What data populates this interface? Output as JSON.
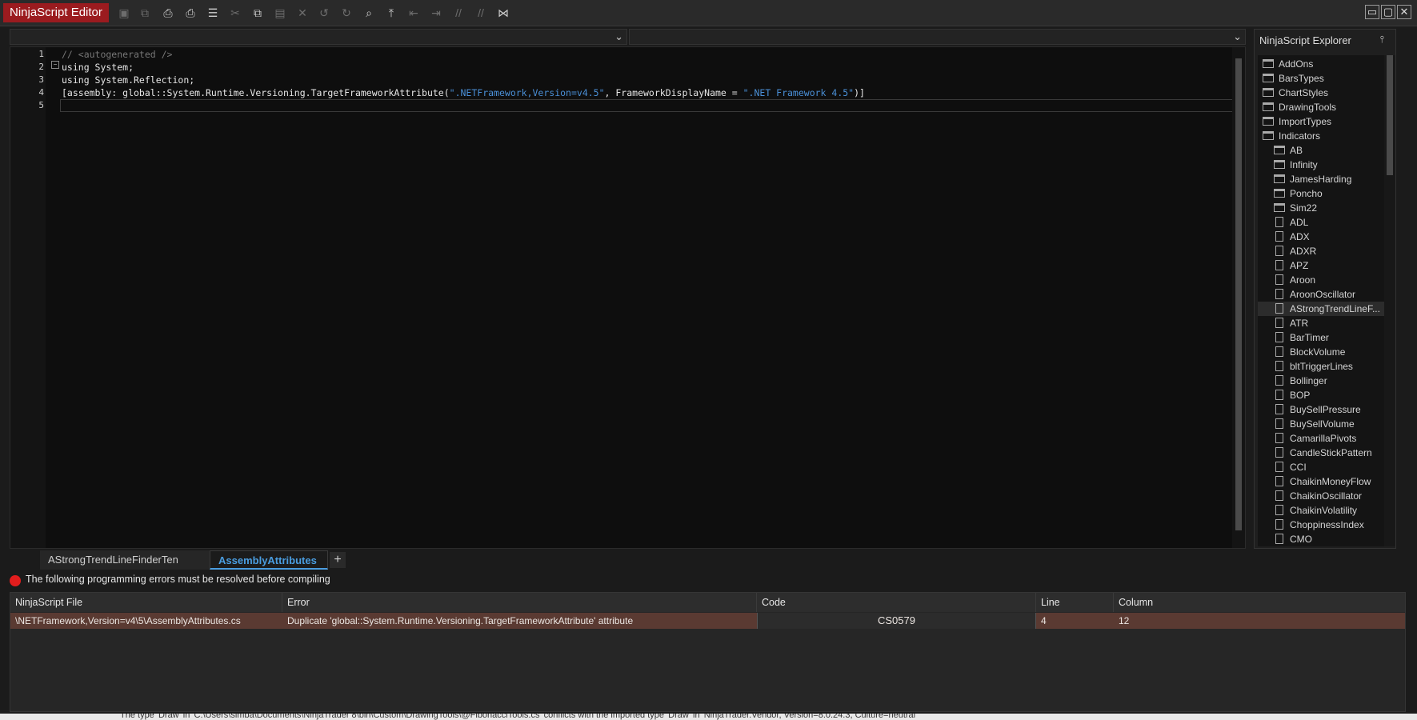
{
  "window": {
    "title": "NinjaScript Editor",
    "toolbar_icons": [
      "save-icon",
      "save-all-icon",
      "print-icon",
      "print-preview-icon",
      "template-icon",
      "cut-icon",
      "copy-icon",
      "paste-icon",
      "delete-icon",
      "undo-icon",
      "redo-icon",
      "find-icon",
      "insert-icon",
      "outdent-icon",
      "indent-icon",
      "comment-icon",
      "uncomment-icon",
      "visual-studio-icon"
    ],
    "controls": {
      "minimize": "▭",
      "maximize": "▢",
      "close": "✕"
    }
  },
  "editor": {
    "line_numbers": [
      "1",
      "2",
      "3",
      "4",
      "5"
    ],
    "lines": {
      "l1": "// <autogenerated />",
      "l2": "using System;",
      "l3": "using System.Reflection;",
      "l4_a": "[assembly: global::System.Runtime.Versioning.TargetFrameworkAttribute(",
      "l4_s1": "\".NETFramework,Version=v4.5\"",
      "l4_b": ", FrameworkDisplayName = ",
      "l4_s2": "\".NET Framework 4.5\"",
      "l4_c": ")]"
    }
  },
  "explorer": {
    "title": "NinjaScript Explorer",
    "folders_root": [
      "AddOns",
      "BarsTypes",
      "ChartStyles",
      "DrawingTools",
      "ImportTypes",
      "Indicators"
    ],
    "folders_indicators": [
      "AB",
      "Infinity",
      "JamesHarding",
      "Poncho",
      "Sim22"
    ],
    "files": [
      "ADL",
      "ADX",
      "ADXR",
      "APZ",
      "Aroon",
      "AroonOscillator",
      "AStrongTrendLineF...",
      "ATR",
      "BarTimer",
      "BlockVolume",
      "bltTriggerLines",
      "Bollinger",
      "BOP",
      "BuySellPressure",
      "BuySellVolume",
      "CamarillaPivots",
      "CandleStickPattern",
      "CCI",
      "ChaikinMoneyFlow",
      "ChaikinOscillator",
      "ChaikinVolatility",
      "ChoppinessIndex",
      "CMO"
    ],
    "selected": "AStrongTrendLineF..."
  },
  "tabs": [
    {
      "label": "AStrongTrendLineFinderTen"
    },
    {
      "label": "AssemblyAttributes"
    }
  ],
  "tab_add": "+",
  "errors": {
    "message": "The following programming errors must be resolved before compiling",
    "columns": [
      "NinjaScript File",
      "Error",
      "Code",
      "Line",
      "Column"
    ],
    "rows": [
      {
        "file": "\\NETFramework,Version=v4\\5\\AssemblyAttributes.cs",
        "error": "Duplicate 'global::System.Runtime.Versioning.TargetFrameworkAttribute' attribute",
        "code": "CS0579",
        "line": "4",
        "column": "12"
      }
    ]
  },
  "status_text": "The type 'Draw' in 'C:\\Users\\simba\\Documents\\NinjaTrader 8\\bin\\Custom\\DrawingTools\\@FibonacciTools.cs' conflicts with the imported type 'Draw' in 'NinjaTrader.Vendor, Version=8.0.24.3, Culture=neutral'"
}
